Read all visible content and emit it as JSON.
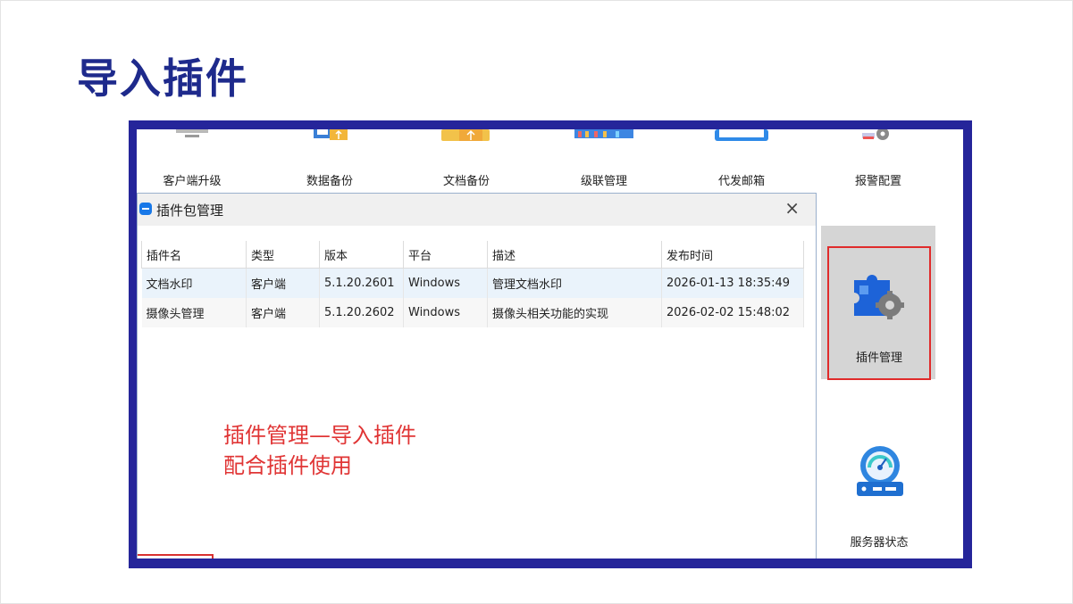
{
  "slide": {
    "title": "导入插件"
  },
  "toolbar": {
    "items": [
      {
        "label": "客户端升级",
        "icon": "monitor-icon"
      },
      {
        "label": "数据备份",
        "icon": "data-backup-icon"
      },
      {
        "label": "文档备份",
        "icon": "folder-backup-icon"
      },
      {
        "label": "级联管理",
        "icon": "cascade-icon"
      },
      {
        "label": "代发邮箱",
        "icon": "mailbox-icon"
      },
      {
        "label": "报警配置",
        "icon": "alarm-config-icon"
      }
    ]
  },
  "dialog": {
    "title": "插件包管理",
    "close": "×",
    "columns": [
      "插件名",
      "类型",
      "版本",
      "平台",
      "描述",
      "发布时间"
    ],
    "rows": [
      [
        "文档水印",
        "客户端",
        "5.1.20.2601",
        "Windows",
        "管理文档水印",
        "2026-01-13 18:35:49"
      ],
      [
        "摄像头管理",
        "客户端",
        "5.1.20.2602",
        "Windows",
        "摄像头相关功能的实现",
        "2026-02-02 15:48:02"
      ]
    ]
  },
  "annotation": {
    "line1": "插件管理—导入插件",
    "line2": "配合插件使用"
  },
  "side": {
    "plugin_label": "插件管理",
    "server_label": "服务器状态"
  },
  "colors": {
    "title": "#1e2a8c",
    "frame": "#25259a",
    "annotation": "#e03535",
    "highlight": "#e02b2b",
    "selected_row": "#eaf3fb"
  }
}
